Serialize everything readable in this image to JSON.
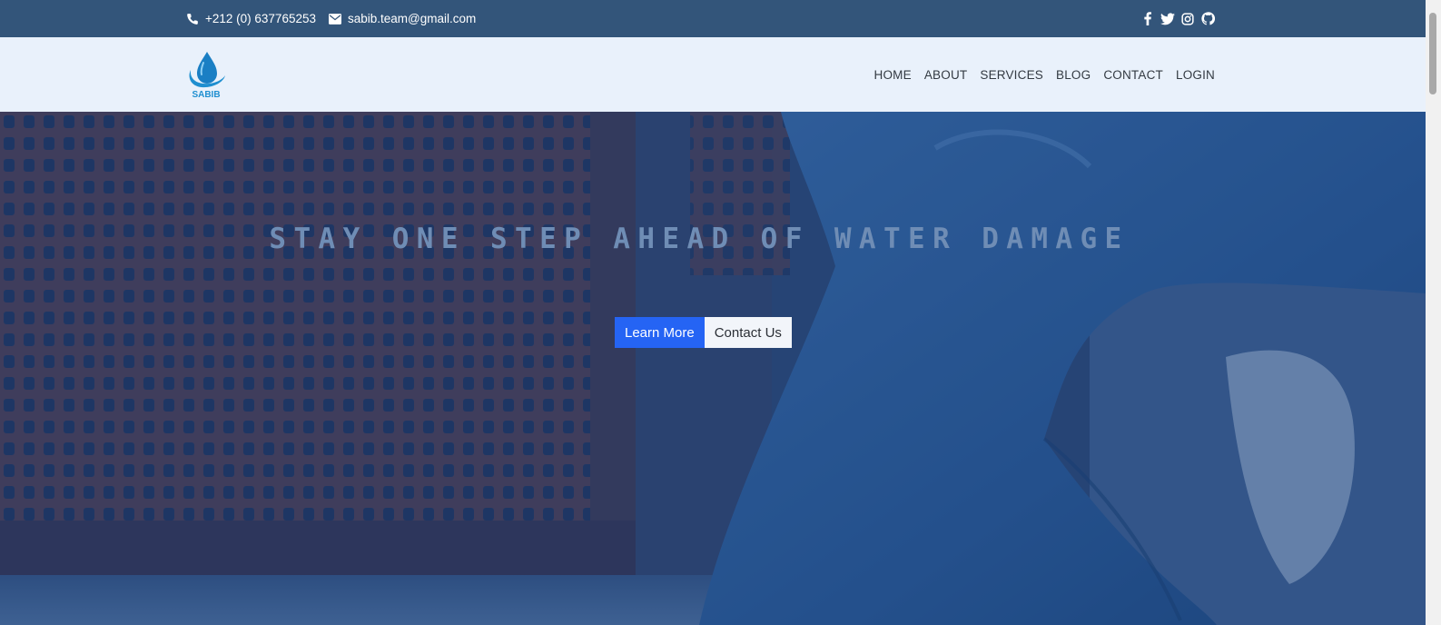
{
  "topbar": {
    "phone": "+212 (0) 637765253",
    "email": "sabib.team@gmail.com",
    "social_icons": [
      "facebook-icon",
      "twitter-icon",
      "instagram-icon",
      "github-icon"
    ]
  },
  "navbar": {
    "logo_text": "SABIB",
    "items": [
      "HOME",
      "ABOUT",
      "SERVICES",
      "BLOG",
      "CONTACT",
      "LOGIN"
    ]
  },
  "hero": {
    "title": "STAY ONE STEP AHEAD OF WATER DAMAGE",
    "primary_button": "Learn More",
    "secondary_button": "Contact Us"
  },
  "colors": {
    "topbar": "#33557a",
    "navbar": "#e9f1fb",
    "accent": "#2564f4",
    "logo": "#1f8fd0"
  }
}
